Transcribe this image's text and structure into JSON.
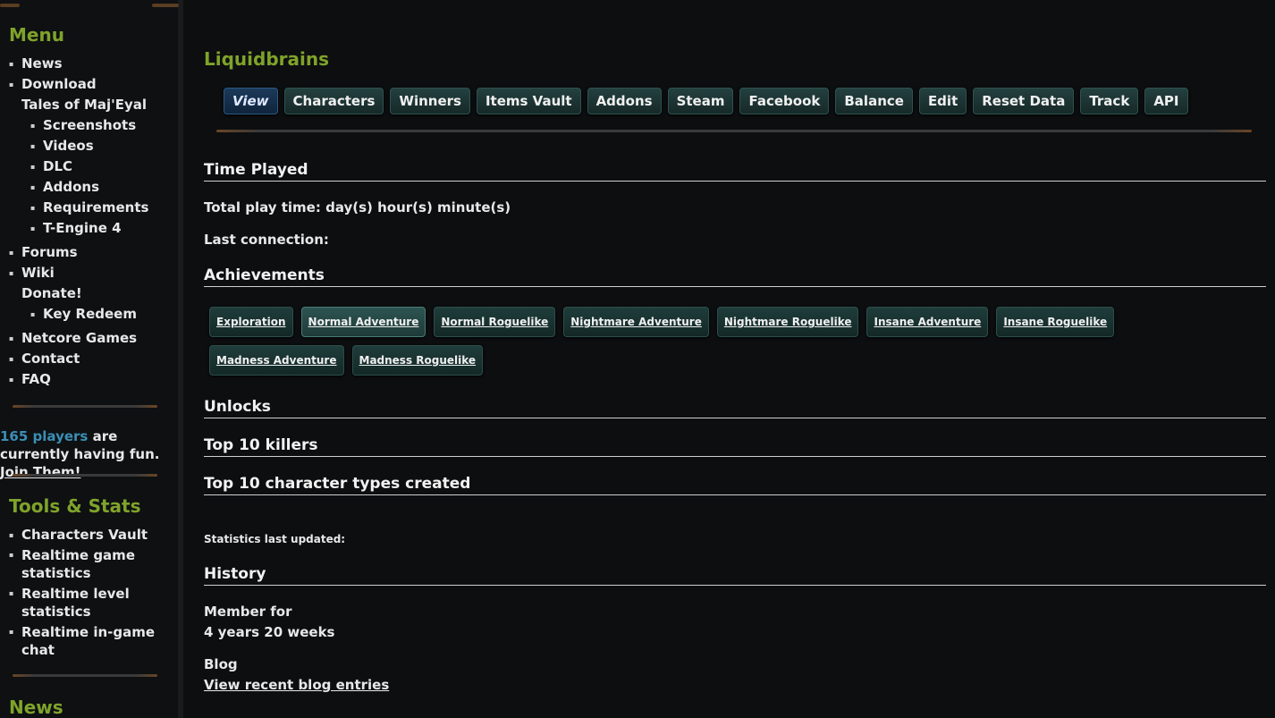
{
  "sidebar": {
    "menu_title": "Menu",
    "menu_items": [
      {
        "label": "News"
      },
      {
        "label": "Download"
      },
      {
        "label": "Tales of Maj'Eyal"
      },
      {
        "label": "Screenshots"
      },
      {
        "label": "Videos"
      },
      {
        "label": "DLC"
      },
      {
        "label": "Addons"
      },
      {
        "label": "Requirements"
      },
      {
        "label": "T-Engine 4"
      },
      {
        "label": "Forums"
      },
      {
        "label": "Wiki"
      },
      {
        "label": "Donate!"
      },
      {
        "label": "Key Redeem"
      },
      {
        "label": "Netcore Games"
      },
      {
        "label": "Contact"
      },
      {
        "label": "FAQ"
      }
    ],
    "players": {
      "count_text": "165 players",
      "suffix": " are currently having fun. ",
      "join_label": "Join Them!"
    },
    "tools_title": "Tools & Stats",
    "tools_items": [
      {
        "label": "Characters Vault"
      },
      {
        "label": "Realtime game statistics"
      },
      {
        "label": "Realtime level statistics"
      },
      {
        "label": "Realtime in-game chat"
      }
    ],
    "news_title": "News"
  },
  "main": {
    "user_title": "Liquidbrains",
    "tabs": [
      {
        "label": "View"
      },
      {
        "label": "Characters"
      },
      {
        "label": "Winners"
      },
      {
        "label": "Items Vault"
      },
      {
        "label": "Addons"
      },
      {
        "label": "Steam"
      },
      {
        "label": "Facebook"
      },
      {
        "label": "Balance"
      },
      {
        "label": "Edit"
      },
      {
        "label": "Reset Data"
      },
      {
        "label": "Track"
      },
      {
        "label": "API"
      }
    ],
    "time_played": {
      "heading": "Time Played",
      "total_text": "Total play time: day(s) hour(s) minute(s)",
      "last_text": "Last connection:"
    },
    "achievements": {
      "heading": "Achievements",
      "items": [
        {
          "label": "Exploration"
        },
        {
          "label": "Normal Adventure"
        },
        {
          "label": "Normal Roguelike"
        },
        {
          "label": "Nightmare Adventure"
        },
        {
          "label": "Nightmare Roguelike"
        },
        {
          "label": "Insane Adventure"
        },
        {
          "label": "Insane Roguelike"
        },
        {
          "label": "Madness Adventure"
        },
        {
          "label": "Madness Roguelike"
        }
      ]
    },
    "unlocks_heading": "Unlocks",
    "killers_heading": "Top 10 killers",
    "types_heading": "Top 10 character types created",
    "stats_updated": "Statistics last updated:",
    "history": {
      "heading": "History",
      "member_label": "Member for",
      "member_value": "4 years 20 weeks",
      "blog_label": "Blog",
      "blog_link": "View recent blog entries"
    }
  }
}
